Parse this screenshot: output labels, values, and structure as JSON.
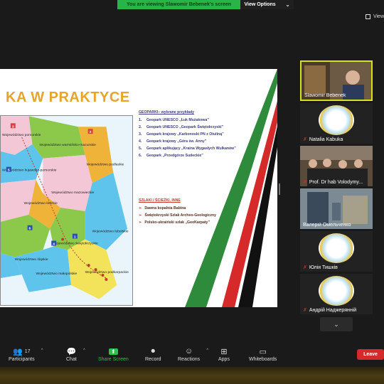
{
  "banner": {
    "message": "You are viewing Slawomir Bebenek's screen",
    "options": "View Options",
    "chevron": "⌄"
  },
  "view": {
    "label": "View"
  },
  "slide": {
    "title": "KA W PRAKTYCE",
    "geoparks_heading": "GEOPARKI– wybrane przykłady",
    "geoparks": [
      {
        "n": "1.",
        "text": "Geopark UNESCO „Łuk Mużakowa”"
      },
      {
        "n": "2.",
        "text": "Geopark UNESCO „Geopark Świętokrzyski”"
      },
      {
        "n": "3.",
        "text": "Geopark krajowy „Karkonoski PN z Otuliną”"
      },
      {
        "n": "4.",
        "text": "Geopark krajowy „Góra św. Anny”"
      },
      {
        "n": "5.",
        "text": "Geopark aplikujący „Kraina Wygasłych Wulkanów”"
      },
      {
        "n": "6.",
        "text": "Geopark „Przedgórze Sudeckie”"
      }
    ],
    "trails_heading": "SZLAKI / ŚCIEŻKI, INNE",
    "trails": [
      {
        "arrow": "➢",
        "text": "Dawna kopalnia Babina"
      },
      {
        "arrow": "➢",
        "text": "Świętokrzyski Szlak Archeo-Geologiczny"
      },
      {
        "arrow": "➢",
        "text": "Polsko-ukraiński szlak „GeoKarpaty”"
      }
    ],
    "map_labels": {
      "pomorskie": "Województwo pomorskie",
      "warminsko": "Województwo warmińsko-mazurskie",
      "podlaskie": "Województwo podlaskie",
      "kujawsko": "Województwo kujawsko-pomorskie",
      "mazowieckie": "Województwo mazowieckie",
      "lodzkie": "Województwo łódzkie",
      "lubelskie": "Województwo lubelskie",
      "swietokrzyskie": "Województwo świętokrzyskie",
      "slaskie": "Województwo śląskie",
      "malopolskie": "Województwo małopolskie",
      "podkarpackie": "Województwo podkarpackie"
    },
    "map_markers": [
      "1",
      "2",
      "3",
      "4",
      "5",
      "6"
    ]
  },
  "participants": [
    {
      "name": "Slawomir Bebenek",
      "muted": false,
      "active": true
    },
    {
      "name": "Natalia Kabuka",
      "muted": true
    },
    {
      "name": "Prof. Dr hab Volodymy...",
      "muted": true
    },
    {
      "name": "Валерій Омельченко",
      "muted": true
    },
    {
      "name": "Юлія Тишків",
      "muted": true
    },
    {
      "name": "Андрій Наджерянній",
      "muted": true
    }
  ],
  "toolbar": {
    "participants_label": "Participants",
    "participants_count": "17",
    "chat_label": "Chat",
    "share_label": "Share Screen",
    "record_label": "Record",
    "reactions_label": "Reactions",
    "apps_label": "Apps",
    "whiteboards_label": "Whiteboards",
    "leave_label": "Leave"
  },
  "colors": {
    "share_green": "#28c34a",
    "leave_red": "#d42a2a",
    "active_border": "#d8e21a"
  }
}
